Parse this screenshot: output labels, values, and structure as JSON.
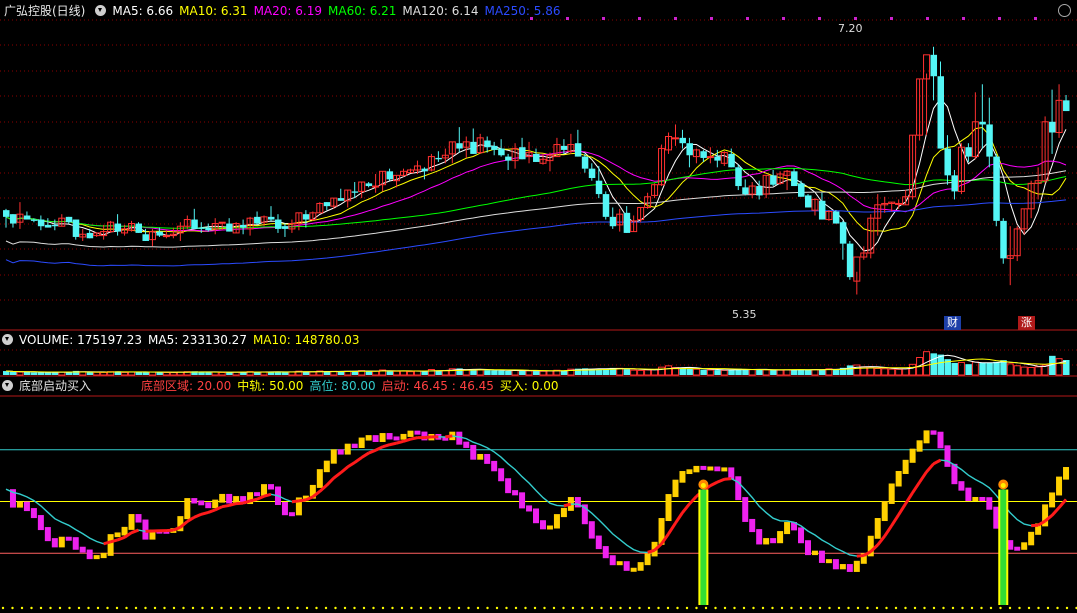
{
  "header": {
    "stock": "广弘控股(日线)",
    "ma": [
      {
        "label": "MA5: 6.66",
        "color": "#ffffff"
      },
      {
        "label": "MA10: 6.31",
        "color": "#ffff00"
      },
      {
        "label": "MA20: 6.19",
        "color": "#ff00ff"
      },
      {
        "label": "MA60: 6.21",
        "color": "#00ff00"
      },
      {
        "label": "MA120: 6.14",
        "color": "#dddddd"
      },
      {
        "label": "MA250: 5.86",
        "color": "#2b4bff"
      }
    ]
  },
  "price_labels": {
    "high": "7.20",
    "low": "5.35"
  },
  "event_tags": {
    "cai": "财",
    "zhang": "涨"
  },
  "volume": {
    "labels": [
      {
        "label": "VOLUME: 175197.23",
        "color": "#ffffff"
      },
      {
        "label": "MA5: 233130.27",
        "color": "#ffffff"
      },
      {
        "label": "MA10: 148780.03",
        "color": "#ffff00"
      }
    ]
  },
  "indicator": {
    "title": "底部启动买入",
    "labels": [
      {
        "label": "底部区域: 20.00",
        "color": "#ff4040"
      },
      {
        "label": "中轨: 50.00",
        "color": "#ffff00"
      },
      {
        "label": "高位: 80.00",
        "color": "#33cccc"
      },
      {
        "label": "启动: 46.45 : 46.45",
        "color": "#ff4040"
      },
      {
        "label": "买入: 0.00",
        "color": "#ffff00"
      }
    ]
  },
  "colors": {
    "up": "#ff3030",
    "down": "#54f6f6",
    "bg": "#000000",
    "grid": "#8b0000"
  },
  "chart_data": [
    {
      "type": "candlestick",
      "title": "广弘控股(日线)",
      "series_count": 153,
      "ylim": [
        5.1,
        7.4
      ],
      "annotations": [
        {
          "text": "7.20",
          "value": 7.2
        },
        {
          "text": "5.35",
          "value": 5.35
        }
      ],
      "candles": [
        [
          5.98,
          5.99,
          5.85,
          5.93
        ],
        [
          5.95,
          5.95,
          5.85,
          5.88
        ],
        [
          5.89,
          6.04,
          5.84,
          5.95
        ],
        [
          5.94,
          5.97,
          5.91,
          5.91
        ],
        [
          5.91,
          5.92,
          5.89,
          5.9
        ],
        [
          5.91,
          5.94,
          5.83,
          5.86
        ],
        [
          5.87,
          5.92,
          5.85,
          5.85
        ],
        [
          5.87,
          5.91,
          5.83,
          5.86
        ],
        [
          5.86,
          5.95,
          5.86,
          5.92
        ],
        [
          5.93,
          5.93,
          5.88,
          5.89
        ],
        [
          5.91,
          5.91,
          5.76,
          5.78
        ],
        [
          5.78,
          5.84,
          5.75,
          5.8
        ],
        [
          5.81,
          5.84,
          5.77,
          5.77
        ],
        [
          5.79,
          5.81,
          5.78,
          5.81
        ],
        [
          5.79,
          5.87,
          5.76,
          5.82
        ],
        [
          5.82,
          5.9,
          5.81,
          5.89
        ],
        [
          5.88,
          5.95,
          5.79,
          5.82
        ],
        [
          5.81,
          5.87,
          5.79,
          5.84
        ],
        [
          5.83,
          5.9,
          5.82,
          5.88
        ],
        [
          5.88,
          5.89,
          5.81,
          5.81
        ],
        [
          5.8,
          5.84,
          5.75,
          5.75
        ],
        [
          5.76,
          5.84,
          5.71,
          5.82
        ],
        [
          5.82,
          5.85,
          5.78,
          5.79
        ],
        [
          5.79,
          5.83,
          5.77,
          5.79
        ],
        [
          5.79,
          5.85,
          5.77,
          5.8
        ],
        [
          5.81,
          5.89,
          5.75,
          5.86
        ],
        [
          5.86,
          5.94,
          5.84,
          5.91
        ],
        [
          5.91,
          5.99,
          5.84,
          5.84
        ],
        [
          5.85,
          5.89,
          5.81,
          5.84
        ],
        [
          5.85,
          5.88,
          5.82,
          5.83
        ],
        [
          5.84,
          5.92,
          5.8,
          5.88
        ],
        [
          5.89,
          5.89,
          5.83,
          5.89
        ],
        [
          5.88,
          5.92,
          5.82,
          5.82
        ],
        [
          5.81,
          5.89,
          5.81,
          5.88
        ],
        [
          5.87,
          5.91,
          5.8,
          5.85
        ],
        [
          5.84,
          5.93,
          5.79,
          5.92
        ],
        [
          5.93,
          5.97,
          5.87,
          5.88
        ],
        [
          5.89,
          5.94,
          5.86,
          5.93
        ],
        [
          5.93,
          6.01,
          5.9,
          5.91
        ],
        [
          5.91,
          5.95,
          5.81,
          5.84
        ],
        [
          5.86,
          5.88,
          5.78,
          5.84
        ],
        [
          5.84,
          5.91,
          5.81,
          5.88
        ],
        [
          5.88,
          5.96,
          5.83,
          5.96
        ],
        [
          5.95,
          5.98,
          5.85,
          5.91
        ],
        [
          5.91,
          5.97,
          5.9,
          5.96
        ],
        [
          5.96,
          6.04,
          5.96,
          6.03
        ],
        [
          6.04,
          6.04,
          5.98,
          6.01
        ],
        [
          6.01,
          6.07,
          5.99,
          6.07
        ],
        [
          6.07,
          6.14,
          6.05,
          6.05
        ],
        [
          6.05,
          6.13,
          6.0,
          6.13
        ],
        [
          6.12,
          6.19,
          6.07,
          6.11
        ],
        [
          6.12,
          6.19,
          6.07,
          6.19
        ],
        [
          6.18,
          6.19,
          6.15,
          6.16
        ],
        [
          6.16,
          6.25,
          6.11,
          6.16
        ],
        [
          6.17,
          6.27,
          6.12,
          6.27
        ],
        [
          6.27,
          6.29,
          6.2,
          6.21
        ],
        [
          6.2,
          6.24,
          6.15,
          6.24
        ],
        [
          6.24,
          6.29,
          6.23,
          6.27
        ],
        [
          6.26,
          6.29,
          6.26,
          6.28
        ],
        [
          6.28,
          6.35,
          6.25,
          6.31
        ],
        [
          6.29,
          6.3,
          6.21,
          6.27
        ],
        [
          6.28,
          6.4,
          6.27,
          6.38
        ],
        [
          6.37,
          6.42,
          6.34,
          6.36
        ],
        [
          6.37,
          6.44,
          6.33,
          6.39
        ],
        [
          6.4,
          6.49,
          6.33,
          6.49
        ],
        [
          6.48,
          6.6,
          6.41,
          6.44
        ],
        [
          6.45,
          6.53,
          6.37,
          6.49
        ],
        [
          6.49,
          6.59,
          6.4,
          6.4
        ],
        [
          6.41,
          6.55,
          6.4,
          6.52
        ],
        [
          6.5,
          6.53,
          6.41,
          6.45
        ],
        [
          6.46,
          6.49,
          6.39,
          6.43
        ],
        [
          6.44,
          6.51,
          6.38,
          6.39
        ],
        [
          6.38,
          6.4,
          6.28,
          6.35
        ],
        [
          6.35,
          6.48,
          6.29,
          6.44
        ],
        [
          6.45,
          6.52,
          6.36,
          6.36
        ],
        [
          6.38,
          6.49,
          6.33,
          6.41
        ],
        [
          6.4,
          6.44,
          6.34,
          6.34
        ],
        [
          6.33,
          6.4,
          6.32,
          6.36
        ],
        [
          6.35,
          6.41,
          6.27,
          6.39
        ],
        [
          6.38,
          6.52,
          6.38,
          6.47
        ],
        [
          6.46,
          6.51,
          6.4,
          6.43
        ],
        [
          6.42,
          6.55,
          6.4,
          6.47
        ],
        [
          6.48,
          6.58,
          6.38,
          6.38
        ],
        [
          6.38,
          6.4,
          6.26,
          6.29
        ],
        [
          6.29,
          6.33,
          6.2,
          6.22
        ],
        [
          6.2,
          6.31,
          6.07,
          6.1
        ],
        [
          6.1,
          6.12,
          5.91,
          5.93
        ],
        [
          5.93,
          6.0,
          5.84,
          5.86
        ],
        [
          5.87,
          5.99,
          5.82,
          5.95
        ],
        [
          5.96,
          6.01,
          5.81,
          5.81
        ],
        [
          5.82,
          5.94,
          5.82,
          5.9
        ],
        [
          5.91,
          6.0,
          5.89,
          6.0
        ],
        [
          6.0,
          6.11,
          5.99,
          6.08
        ],
        [
          6.09,
          6.18,
          6.07,
          6.17
        ],
        [
          6.17,
          6.47,
          6.16,
          6.44
        ],
        [
          6.43,
          6.56,
          6.4,
          6.53
        ],
        [
          6.52,
          6.62,
          6.46,
          6.52
        ],
        [
          6.52,
          6.58,
          6.44,
          6.48
        ],
        [
          6.48,
          6.52,
          6.3,
          6.39
        ],
        [
          6.38,
          6.44,
          6.33,
          6.43
        ],
        [
          6.42,
          6.43,
          6.34,
          6.37
        ],
        [
          6.38,
          6.45,
          6.33,
          6.38
        ],
        [
          6.38,
          6.43,
          6.3,
          6.35
        ],
        [
          6.33,
          6.42,
          6.31,
          6.41
        ],
        [
          6.4,
          6.44,
          6.3,
          6.3
        ],
        [
          6.3,
          6.32,
          6.13,
          6.16
        ],
        [
          6.15,
          6.21,
          6.09,
          6.1
        ],
        [
          6.1,
          6.19,
          6.07,
          6.16
        ],
        [
          6.16,
          6.2,
          6.06,
          6.09
        ],
        [
          6.1,
          6.24,
          6.07,
          6.24
        ],
        [
          6.24,
          6.28,
          6.16,
          6.17
        ],
        [
          6.18,
          6.27,
          6.17,
          6.25
        ],
        [
          6.24,
          6.28,
          6.13,
          6.27
        ],
        [
          6.27,
          6.29,
          6.16,
          6.16
        ],
        [
          6.18,
          6.2,
          6.08,
          6.08
        ],
        [
          6.09,
          6.1,
          6.0,
          6.0
        ],
        [
          5.98,
          6.07,
          5.94,
          6.06
        ],
        [
          6.05,
          6.11,
          5.91,
          5.91
        ],
        [
          5.91,
          5.98,
          5.9,
          5.97
        ],
        [
          5.97,
          5.98,
          5.88,
          5.88
        ],
        [
          5.89,
          5.9,
          5.61,
          5.73
        ],
        [
          5.73,
          5.75,
          5.46,
          5.48
        ],
        [
          5.45,
          5.52,
          5.35,
          5.63
        ],
        [
          5.63,
          5.71,
          5.61,
          5.66
        ],
        [
          5.66,
          5.95,
          5.62,
          5.92
        ],
        [
          5.92,
          6.1,
          5.79,
          6.02
        ],
        [
          6.02,
          6.08,
          5.96,
          6.03
        ],
        [
          6.03,
          6.04,
          5.97,
          6.04
        ],
        [
          6.03,
          6.06,
          5.99,
          6.03
        ],
        [
          6.02,
          6.13,
          6.02,
          6.08
        ],
        [
          6.08,
          6.54,
          6.06,
          6.54
        ],
        [
          6.54,
          6.96,
          6.5,
          6.96
        ],
        [
          6.96,
          7.0,
          6.54,
          7.14
        ],
        [
          7.14,
          7.2,
          6.8,
          6.98
        ],
        [
          6.98,
          7.09,
          6.44,
          6.44
        ],
        [
          6.44,
          6.54,
          6.17,
          6.24
        ],
        [
          6.24,
          6.28,
          6.06,
          6.12
        ],
        [
          6.12,
          6.48,
          6.1,
          6.45
        ],
        [
          6.45,
          6.48,
          6.34,
          6.38
        ],
        [
          6.38,
          6.86,
          6.36,
          6.64
        ],
        [
          6.64,
          6.92,
          6.44,
          6.62
        ],
        [
          6.62,
          6.82,
          6.3,
          6.38
        ],
        [
          6.38,
          6.4,
          5.86,
          5.9
        ],
        [
          5.9,
          5.92,
          5.58,
          5.62
        ],
        [
          5.62,
          5.86,
          5.42,
          5.64
        ],
        [
          5.64,
          5.86,
          5.6,
          5.84
        ],
        [
          5.84,
          5.99,
          5.8,
          5.99
        ],
        [
          5.99,
          6.2,
          5.92,
          6.18
        ],
        [
          6.18,
          6.3,
          6.06,
          6.2
        ],
        [
          6.2,
          6.68,
          6.18,
          6.64
        ],
        [
          6.64,
          6.88,
          6.4,
          6.56
        ],
        [
          6.56,
          6.92,
          6.52,
          6.8
        ],
        [
          6.8,
          6.84,
          6.72,
          6.72
        ]
      ]
    },
    {
      "type": "bar",
      "title": "VOLUME",
      "values": [
        95,
        80,
        70,
        74,
        60,
        66,
        62,
        70,
        72,
        65,
        98,
        76,
        70,
        66,
        62,
        80,
        88,
        62,
        70,
        64,
        82,
        72,
        66,
        60,
        58,
        72,
        80,
        90,
        70,
        66,
        72,
        60,
        64,
        70,
        66,
        82,
        70,
        74,
        80,
        76,
        70,
        74,
        92,
        78,
        72,
        96,
        82,
        88,
        96,
        90,
        99,
        106,
        86,
        92,
        120,
        104,
        90,
        92,
        80,
        98,
        96,
        132,
        110,
        106,
        150,
        158,
        128,
        132,
        122,
        116,
        110,
        106,
        96,
        110,
        120,
        100,
        92,
        90,
        96,
        114,
        112,
        140,
        152,
        160,
        150,
        142,
        156,
        170,
        160,
        140,
        116,
        110,
        120,
        130,
        188,
        220,
        178,
        172,
        156,
        140,
        126,
        120,
        118,
        112,
        132,
        150,
        136,
        128,
        130,
        124,
        120,
        116,
        124,
        130,
        134,
        132,
        126,
        130,
        148,
        140,
        172,
        230,
        240,
        196,
        176,
        156,
        150,
        140,
        136,
        150,
        256,
        420,
        560,
        520,
        490,
        380,
        290,
        302,
        260,
        310,
        300,
        300,
        316,
        356,
        268,
        222,
        190,
        180,
        196,
        236,
        460,
        392,
        360
      ],
      "ylim": [
        0,
        600
      ]
    },
    {
      "type": "line",
      "title": "底部启动买入",
      "ylim": [
        -10,
        110
      ],
      "reference_lines": [
        {
          "name": "底部区域",
          "value": 20
        },
        {
          "name": "中轨",
          "value": 50
        },
        {
          "name": "高位",
          "value": 80
        }
      ]
    }
  ]
}
